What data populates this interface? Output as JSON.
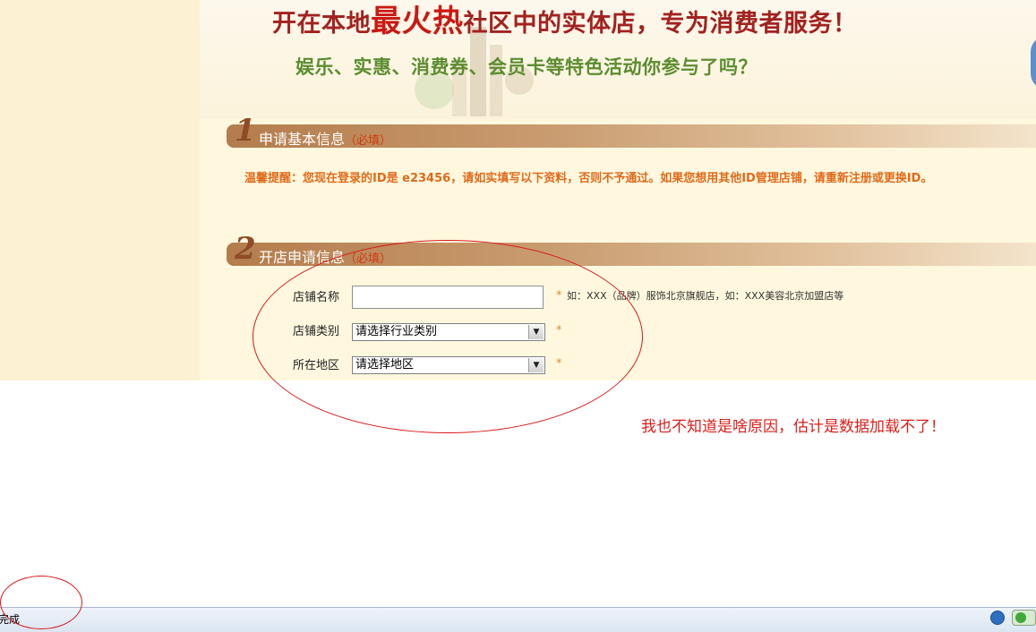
{
  "banner": {
    "headline_part1": "开在本地",
    "headline_highlight": "最火热",
    "headline_part2": "社区中的实体店，专为消费者服务！",
    "tagline": "娱乐、实惠、消费券、会员卡等特色活动你参与了吗？"
  },
  "section1": {
    "number": "1",
    "title": "申请基本信息",
    "required": "（必填）"
  },
  "reminder": "温馨提醒：您现在登录的ID是 e23456，请如实填写以下资料，否则不予通过。如果您想用其他ID管理店铺，请重新注册或更换ID。",
  "section2": {
    "number": "2",
    "title": "开店申请信息",
    "required": "（必填）"
  },
  "form": {
    "shop_name_label": "店铺名称",
    "shop_name_value": "",
    "shop_name_hint": "如：XXX（品牌）服饰北京旗舰店，如：XXX美容北京加盟店等",
    "shop_type_label": "店铺类别",
    "shop_type_selected": "请选择行业类别",
    "region_label": "所在地区",
    "region_selected": "请选择地区",
    "asterisk": "*"
  },
  "annotation": "我也不知道是啥原因，估计是数据加载不了！",
  "status_bar": {
    "text": "完成"
  },
  "colors": {
    "headline": "#a22220",
    "tagline": "#5c8d30",
    "reminder": "#e06a1a",
    "annotation": "#d8201a"
  },
  "icons": [
    "globe-icon",
    "security-toggle-icon",
    "chevron-down-icon"
  ]
}
